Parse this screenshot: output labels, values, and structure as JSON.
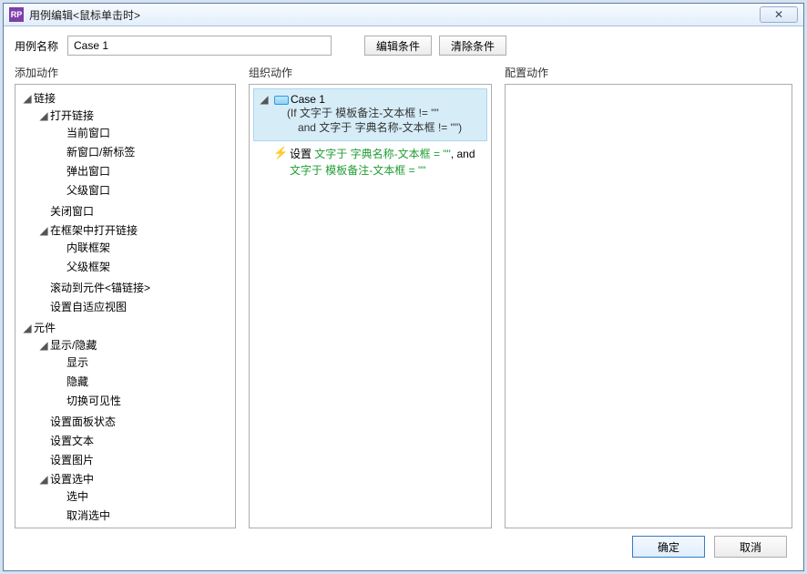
{
  "window": {
    "title": "用例编辑<鼠标单击时>",
    "close_label": "x"
  },
  "toprow": {
    "name_label": "用例名称",
    "case_name": "Case 1",
    "edit_cond": "编辑条件",
    "clear_cond": "清除条件"
  },
  "headers": {
    "add_actions": "添加动作",
    "org_actions": "组织动作",
    "config_actions": "配置动作"
  },
  "tree": {
    "link": {
      "label": "链接",
      "open_link": {
        "label": "打开链接",
        "current_window": "当前窗口",
        "new_window": "新窗口/新标签",
        "popup_window": "弹出窗口",
        "parent_window": "父级窗口"
      },
      "close_window": "关闭窗口",
      "open_in_frame": {
        "label": "在框架中打开链接",
        "inline_frame": "内联框架",
        "parent_frame": "父级框架"
      },
      "scroll_to": "滚动到元件<锚链接>",
      "set_adaptive": "设置自适应视图"
    },
    "widget": {
      "label": "元件",
      "show_hide": {
        "label": "显示/隐藏",
        "show": "显示",
        "hide": "隐藏",
        "toggle": "切换可见性"
      },
      "panel_state": "设置面板状态",
      "set_text": "设置文本",
      "set_image": "设置图片",
      "set_selected": {
        "label": "设置选中",
        "select": "选中",
        "deselect": "取消选中"
      }
    }
  },
  "org": {
    "case_name": "Case 1",
    "cond_line1": "(If 文字于 模板备注-文本框 != \"\"",
    "cond_line2": "and 文字于 字典名称-文本框 != \"\")",
    "action_prefix": "设置 ",
    "action_green1": "文字于 字典名称-文本框 = \"\"",
    "action_mid": ", and",
    "action_green2": "文字于 模板备注-文本框 = \"\""
  },
  "footer": {
    "ok": "确定",
    "cancel": "取消"
  }
}
